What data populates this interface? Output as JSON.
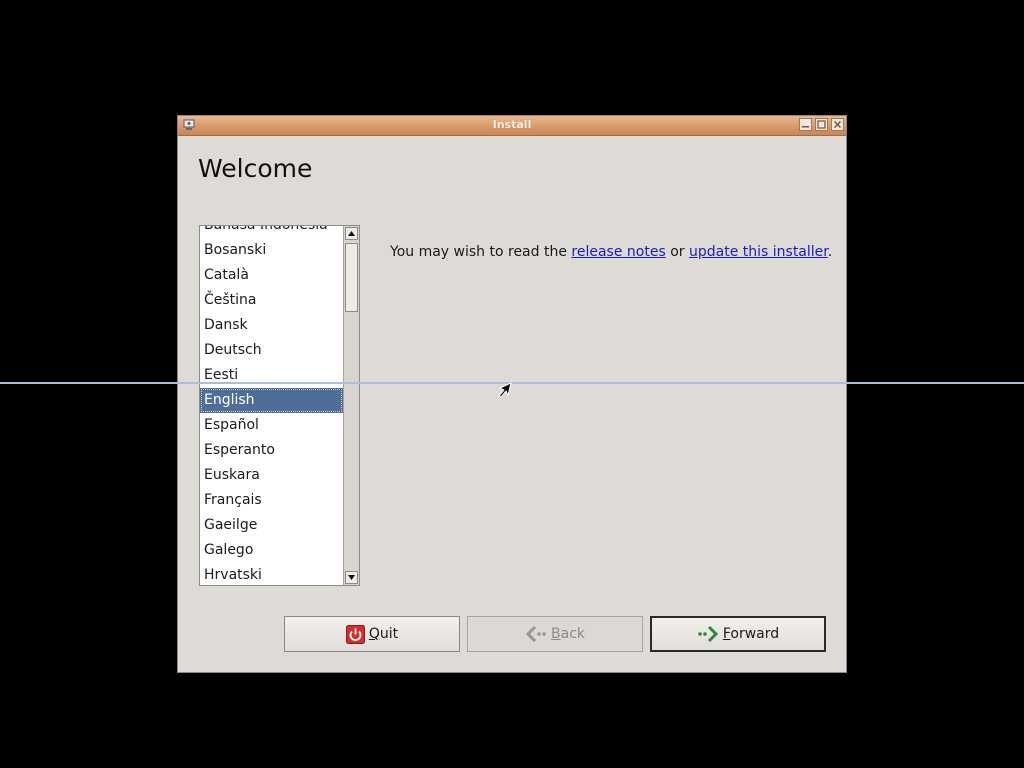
{
  "window": {
    "title": "Install",
    "heading": "Welcome"
  },
  "languages": {
    "items": [
      "Bahasa Indonesia",
      "Bosanski",
      "Català",
      "Čeština",
      "Dansk",
      "Deutsch",
      "Eesti",
      "English",
      "Español",
      "Esperanto",
      "Euskara",
      "Français",
      "Gaeilge",
      "Galego",
      "Hrvatski"
    ],
    "selected": "English"
  },
  "info": {
    "prefix": "You may wish to read the ",
    "link1": "release notes",
    "middle": " or ",
    "link2": "update this installer",
    "suffix": "."
  },
  "buttons": {
    "quit": {
      "mnemonic": "Q",
      "rest": "uit"
    },
    "back": {
      "mnemonic": "B",
      "rest": "ack"
    },
    "forward": {
      "mnemonic": "F",
      "rest": "orward"
    }
  },
  "colors": {
    "titlebar": "#d99a6a",
    "selection": "#4e6e98",
    "link": "#1a1acc",
    "quit_icon": "#d32f2f",
    "arrow_green": "#2e8b2e"
  }
}
